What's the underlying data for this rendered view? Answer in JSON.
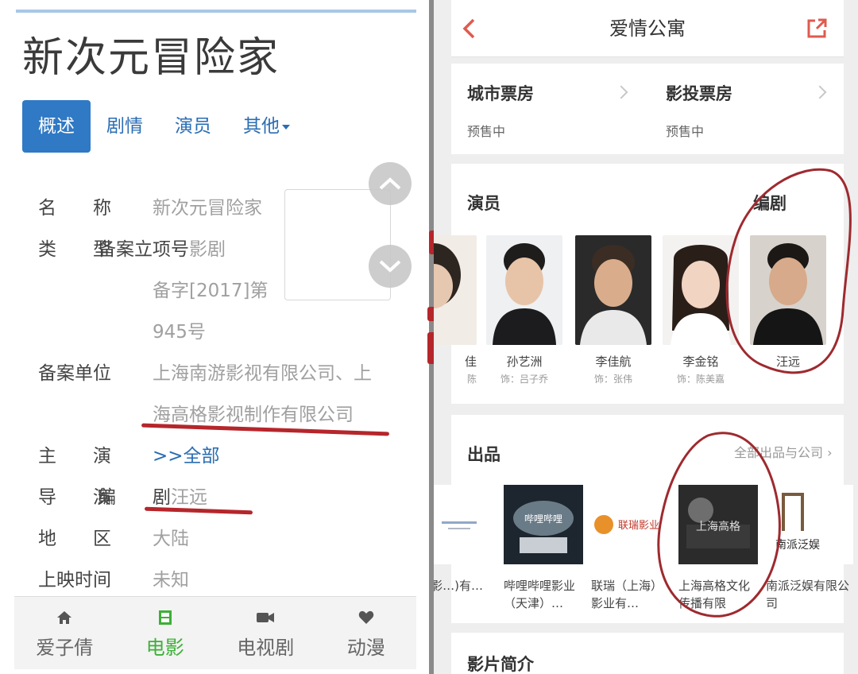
{
  "left": {
    "title": "新次元冒险家",
    "tabs": [
      {
        "label": "概述",
        "active": true
      },
      {
        "label": "剧情",
        "active": false
      },
      {
        "label": "演员",
        "active": false
      },
      {
        "label": "其他",
        "active": false
      }
    ],
    "info": {
      "name_label": "名　　称",
      "name_value": "新次元冒险家",
      "type_label": "类　　型",
      "record_label": "备案立项号",
      "record_value_1": "影剧",
      "record_value_2": "备字[2017]第",
      "record_value_3": "945号",
      "unit_label": "备案单位",
      "unit_value_1": "上海南游影视有限公司、上",
      "unit_value_2": "海高格影视制作有限公司",
      "lead_label": "主　　演",
      "lead_value": ">>全部",
      "director_label": "导　　演",
      "writer_label": "编　　剧",
      "writer_value": "汪远",
      "region_label": "地　　区",
      "region_value": "大陆",
      "release_label": "上映时间",
      "release_value": "未知"
    },
    "bottom_nav": [
      {
        "label": "爱子倩",
        "icon": "home-icon",
        "active": false
      },
      {
        "label": "电影",
        "icon": "film-icon",
        "active": true
      },
      {
        "label": "电视剧",
        "icon": "camera-icon",
        "active": false
      },
      {
        "label": "动漫",
        "icon": "heart-icon",
        "active": false
      }
    ],
    "colors": {
      "tab_active": "#2f79c5",
      "link": "#2a6db3",
      "nav_active": "#3cb036",
      "annotation": "#b5262b"
    }
  },
  "right": {
    "nav_title": "爱情公寓",
    "box_office": [
      {
        "title": "城市票房",
        "status": "预售中"
      },
      {
        "title": "影投票房",
        "status": "预售中"
      }
    ],
    "cast_title": "演员",
    "writer_title": "编剧",
    "cast": [
      {
        "name": "佳",
        "role": "陈"
      },
      {
        "name": "孙艺洲",
        "role": "饰：吕子乔"
      },
      {
        "name": "李佳航",
        "role": "饰：张伟"
      },
      {
        "name": "李金铭",
        "role": "饰：陈美嘉"
      },
      {
        "name": "汪远",
        "role": ""
      }
    ],
    "producers_title": "出品",
    "producers_link": "全部出品与公司",
    "producers": [
      {
        "name": "影…)有…"
      },
      {
        "name": "哔哩哔哩影业（天津）…",
        "logo_text": "哔哩哔哩"
      },
      {
        "name": "联瑞（上海）影业有…",
        "logo_text": "联瑞影业"
      },
      {
        "name": "上海高格文化传播有限",
        "logo_text": "上海高格"
      },
      {
        "name": "南派泛娱有限公司",
        "logo_text": "南派泛娱"
      }
    ],
    "synopsis_title": "影片简介"
  }
}
